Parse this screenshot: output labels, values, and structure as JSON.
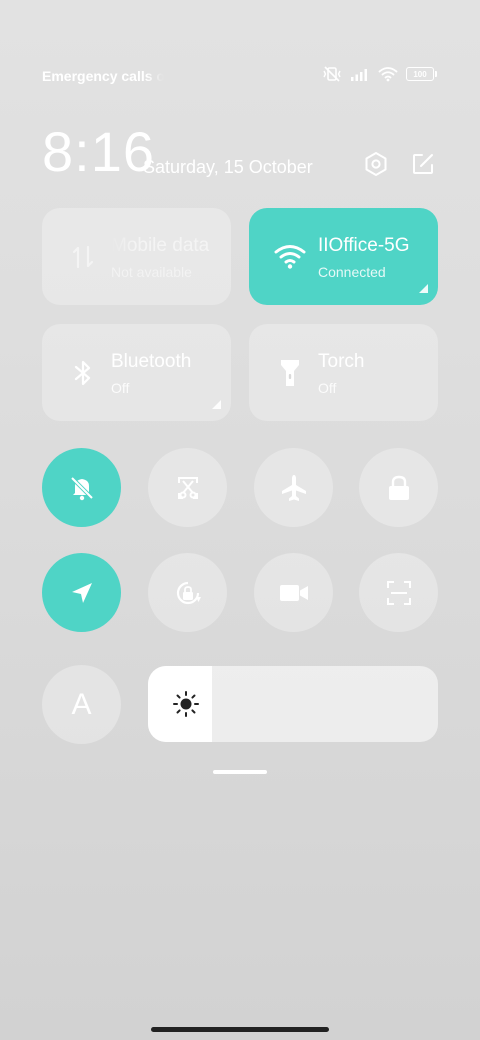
{
  "status_bar": {
    "carrier_text": "Emergency calls only",
    "battery_level": "100"
  },
  "header": {
    "time": "8:16",
    "date": "Saturday, 15 October"
  },
  "tiles": {
    "mobile_data": {
      "title": "Mobile data",
      "status": "Not available",
      "enabled": false
    },
    "wifi": {
      "title": "IIOffice-5G",
      "status": "Connected",
      "enabled": true
    },
    "bluetooth": {
      "title": "Bluetooth",
      "status": "Off",
      "enabled": false
    },
    "torch": {
      "title": "Torch",
      "status": "Off",
      "enabled": false
    }
  },
  "toggles": {
    "do_not_disturb": true,
    "screenshot": false,
    "airplane_mode": false,
    "lock_screen": false,
    "location": true,
    "auto_rotate": false,
    "screen_recorder": false,
    "scanner": false,
    "reading_mode": false
  },
  "reading_mode_letter": "A",
  "brightness": {
    "level": 0.22
  },
  "colors": {
    "accent": "#4fd4c6",
    "tile_bg": "rgba(255,255,255,0.28)"
  }
}
